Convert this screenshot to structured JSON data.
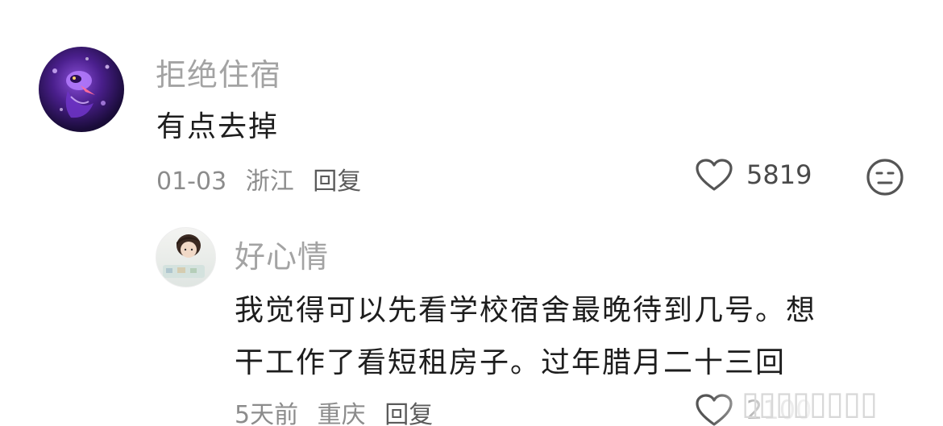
{
  "comment": {
    "username": "拒绝住宿",
    "text": "有点去掉",
    "date": "01-03",
    "location": "浙江",
    "reply_label": "回复",
    "like_count": "5819"
  },
  "reply": {
    "username": "好心情",
    "text_line1": "我觉得可以先看学校宿舍最晚待到几号。想",
    "text_line2": "干工作了看短租房子。过年腊月二十三回",
    "date": "5天前",
    "location": "重庆",
    "reply_label": "回复",
    "like_count": "2100"
  },
  "colors": {
    "username": "#a3a3a3",
    "content": "#1d1d1d",
    "meta": "#8c8c8c",
    "icon": "#555555"
  }
}
